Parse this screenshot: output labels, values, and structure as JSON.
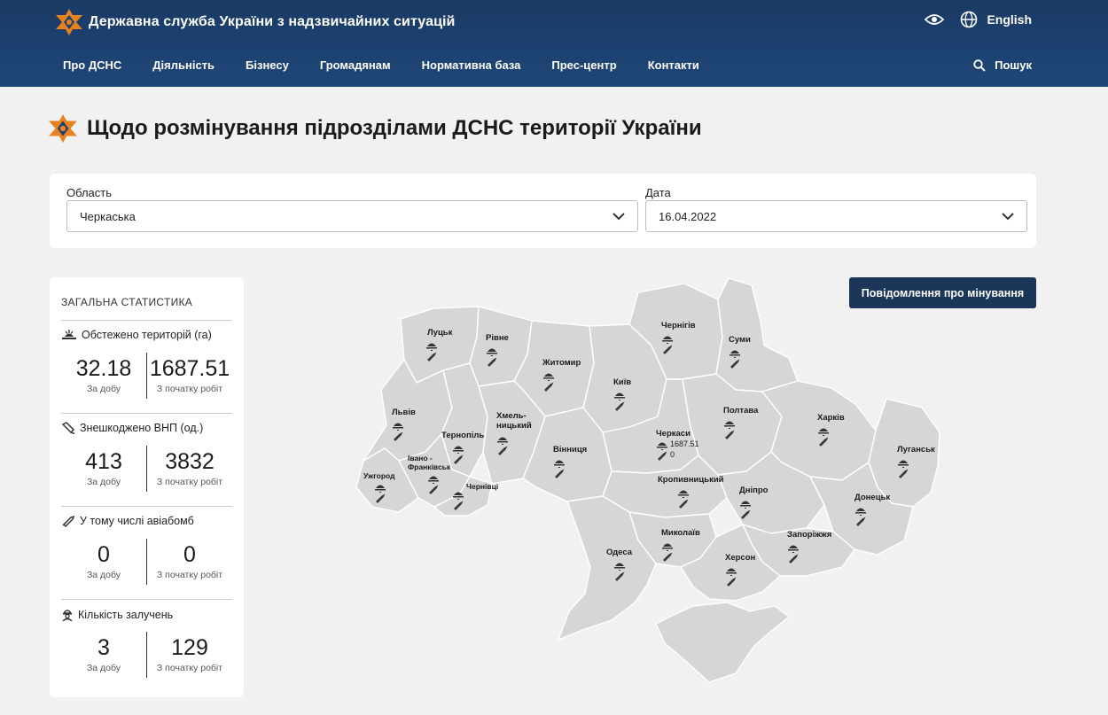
{
  "header": {
    "org_name": "Державна служба України з надзвичайних ситуацій",
    "language": "English",
    "nav": [
      "Про ДСНС",
      "Діяльність",
      "Бізнесу",
      "Громадянам",
      "Нормативна база",
      "Прес-центр",
      "Контакти"
    ],
    "search_label": "Пошук"
  },
  "page": {
    "title": "Щодо розмінування підрозділами ДСНС території України"
  },
  "filters": {
    "region_label": "Область",
    "region_value": "Черкаська",
    "date_label": "Дата",
    "date_value": "16.04.2022"
  },
  "stats": {
    "title": "ЗАГАЛЬНА СТАТИСТИКА",
    "blocks": [
      {
        "icon": "mine-icon",
        "label": "Обстежено територій (га)",
        "day": "32.18",
        "day_label": "За добу",
        "total": "1687.51",
        "total_label": "З початку робіт"
      },
      {
        "icon": "shovel-icon",
        "label": "Знешкоджено ВНП (од.)",
        "day": "413",
        "day_label": "За добу",
        "total": "3832",
        "total_label": "З початку робіт"
      },
      {
        "icon": "bomb-icon",
        "label": "У тому числі авіабомб",
        "day": "0",
        "day_label": "За добу",
        "total": "0",
        "total_label": "З початку робіт"
      },
      {
        "icon": "worker-icon",
        "label": "Кількість залучень",
        "day": "3",
        "day_label": "За добу",
        "total": "129",
        "total_label": "З початку робіт"
      }
    ]
  },
  "report_button": "Повідомлення про мінування",
  "map": {
    "colors": {
      "fill": "#d6d6d6",
      "stroke": "#ffffff",
      "accent": "#e8821e",
      "header": "#1c4170"
    },
    "regions": [
      {
        "id": "lutsk",
        "name": "Луцьк"
      },
      {
        "id": "rivne",
        "name": "Рівне"
      },
      {
        "id": "zhytomyr",
        "name": "Житомир"
      },
      {
        "id": "kyiv",
        "name": "Київ"
      },
      {
        "id": "chernihiv",
        "name": "Чернігів"
      },
      {
        "id": "sumy",
        "name": "Суми"
      },
      {
        "id": "lviv",
        "name": "Львів"
      },
      {
        "id": "ternopil",
        "name": "Тернопіль"
      },
      {
        "id": "khmelnytskyi",
        "name": "Хмель-\nницький"
      },
      {
        "id": "poltava",
        "name": "Полтава"
      },
      {
        "id": "kharkiv",
        "name": "Харків"
      },
      {
        "id": "cherkasy",
        "name": "Черкаси",
        "extra1": "1687.51",
        "extra2": "0"
      },
      {
        "id": "luhansk",
        "name": "Луганськ"
      },
      {
        "id": "ivano",
        "name": "Івано -\nФранківськ"
      },
      {
        "id": "vinnytsia",
        "name": "Вінниця"
      },
      {
        "id": "uzhhorod",
        "name": "Ужгород"
      },
      {
        "id": "chernivtsi",
        "name": "Чернівці"
      },
      {
        "id": "kropyvnytskyi",
        "name": "Кропивницький"
      },
      {
        "id": "dnipro",
        "name": "Дніпро"
      },
      {
        "id": "donetsk",
        "name": "Донецьк"
      },
      {
        "id": "mykolaiv",
        "name": "Миколаїв"
      },
      {
        "id": "zaporizhzhia",
        "name": "Запоріжжя"
      },
      {
        "id": "odesa",
        "name": "Одеса"
      },
      {
        "id": "kherson",
        "name": "Херсон"
      }
    ]
  }
}
